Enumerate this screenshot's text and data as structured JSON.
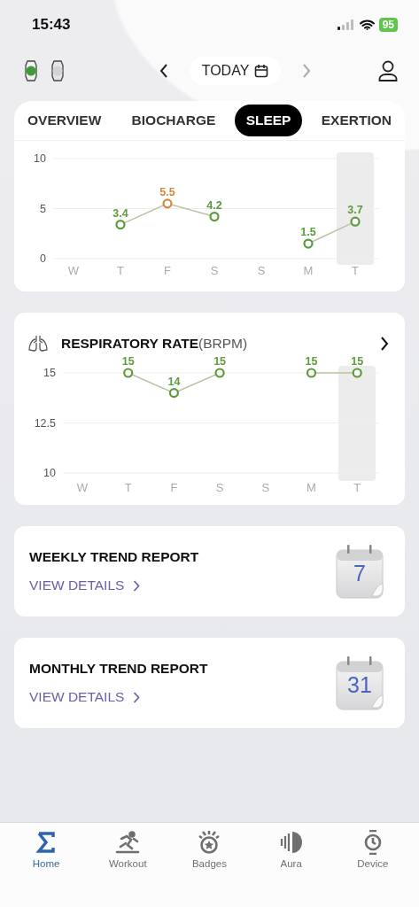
{
  "status_bar": {
    "time": "15:43",
    "battery": "95"
  },
  "devices": [
    {
      "selected": true
    },
    {
      "selected": false
    }
  ],
  "date_nav": {
    "label": "TODAY",
    "next_disabled": true
  },
  "tabs": [
    {
      "label": "OVERVIEW",
      "selected": false
    },
    {
      "label": "BIOCHARGE",
      "selected": false
    },
    {
      "label": "SLEEP",
      "selected": true
    },
    {
      "label": "EXERTION",
      "selected": false
    }
  ],
  "charts": [
    {
      "days": [
        {
          "selected": false
        },
        {
          "selected": false
        },
        {
          "selected": false,
          "color": "#d4873f"
        },
        {
          "selected": false
        },
        {
          "selected": false
        },
        {
          "selected": false
        },
        {
          "selected": true
        }
      ],
      "chart_data": {
        "type": "line",
        "categories": [
          "W",
          "T",
          "F",
          "S",
          "S",
          "M",
          "T"
        ],
        "ylim": [
          0,
          10
        ],
        "yticks": [
          0,
          5,
          10
        ],
        "data_labels": true,
        "series": [
          {
            "color": "#5c9a3c",
            "marker": "o",
            "values": [
              null,
              3.4,
              5.5,
              4.2,
              null,
              1.5,
              3.7
            ]
          }
        ]
      }
    },
    {
      "title": "**RESPIRATORY RATE**(BRPM)",
      "days": [
        {
          "selected": false
        },
        {
          "selected": false
        },
        {
          "selected": false
        },
        {
          "selected": false
        },
        {
          "selected": false
        },
        {
          "selected": false
        },
        {
          "selected": true
        }
      ],
      "chart_data": {
        "type": "line",
        "categories": [
          "W",
          "T",
          "F",
          "S",
          "S",
          "M",
          "T"
        ],
        "ylim": [
          10,
          15
        ],
        "yticks": [
          10,
          12.5,
          15
        ],
        "data_labels": true,
        "series": [
          {
            "color": "#5c9a3c",
            "marker": "o",
            "values": [
              null,
              15,
              14,
              15,
              null,
              15,
              15
            ]
          }
        ]
      }
    }
  ],
  "reports": [
    {
      "title": "WEEKLY TREND REPORT",
      "link": "VIEW DETAILS",
      "day": "7"
    },
    {
      "title": "MONTHLY TREND REPORT",
      "link": "VIEW DETAILS",
      "day": "31"
    }
  ],
  "nav": [
    {
      "label": "Home",
      "selected": true
    },
    {
      "label": "Workout",
      "selected": false
    },
    {
      "label": "Badges",
      "selected": false
    },
    {
      "label": "Aura",
      "selected": false
    },
    {
      "label": "Device",
      "selected": false
    }
  ]
}
